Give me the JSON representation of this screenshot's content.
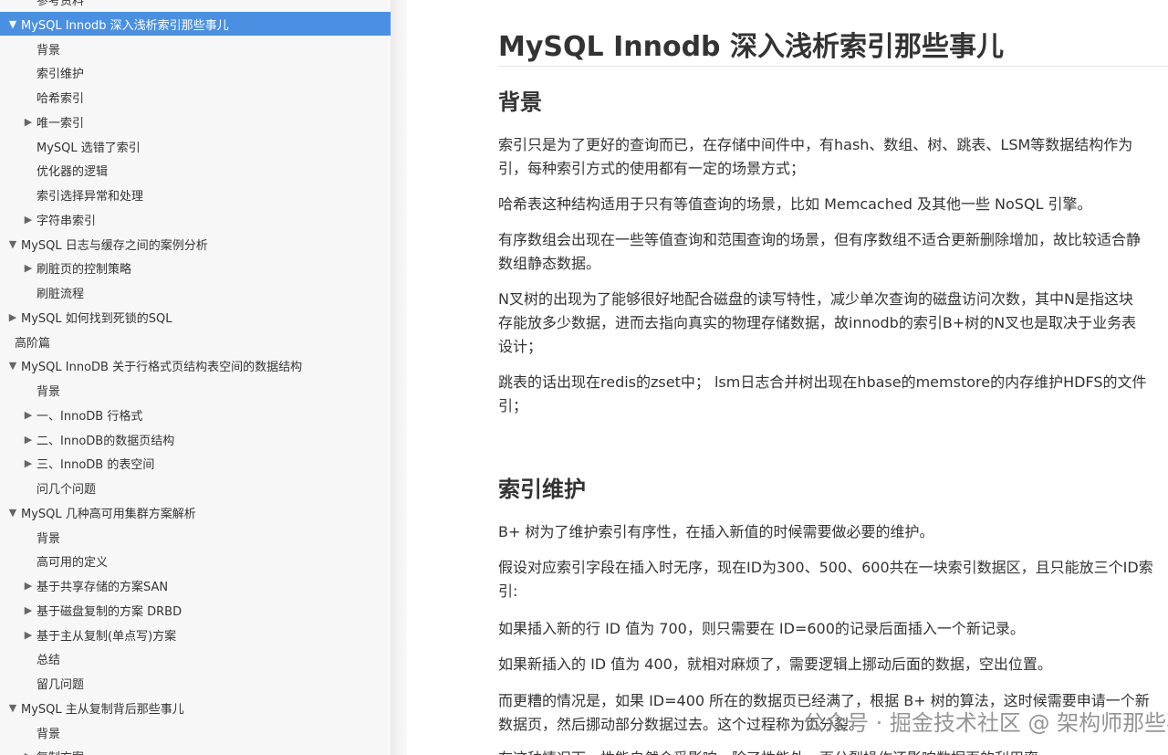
{
  "sidebar": {
    "items": [
      {
        "label": "参考资料",
        "arrow": "",
        "level": 2,
        "active": false
      },
      {
        "label": "MySQL Innodb 深入浅析索引那些事儿",
        "arrow": "▼",
        "level": 1,
        "active": true
      },
      {
        "label": "背景",
        "arrow": "",
        "level": 2,
        "active": false
      },
      {
        "label": "索引维护",
        "arrow": "",
        "level": 2,
        "active": false
      },
      {
        "label": "哈希索引",
        "arrow": "",
        "level": 2,
        "active": false
      },
      {
        "label": "唯一索引",
        "arrow": "▶",
        "level": 2,
        "active": false
      },
      {
        "label": "MySQL 选错了索引",
        "arrow": "",
        "level": 2,
        "active": false
      },
      {
        "label": "优化器的逻辑",
        "arrow": "",
        "level": 2,
        "active": false
      },
      {
        "label": "索引选择异常和处理",
        "arrow": "",
        "level": 2,
        "active": false
      },
      {
        "label": "字符串索引",
        "arrow": "▶",
        "level": 2,
        "active": false
      },
      {
        "label": "MySQL 日志与缓存之间的案例分析",
        "arrow": "▼",
        "level": 1,
        "active": false
      },
      {
        "label": "刷脏页的控制策略",
        "arrow": "▶",
        "level": 2,
        "active": false
      },
      {
        "label": "刷脏流程",
        "arrow": "",
        "level": 2,
        "active": false
      },
      {
        "label": "MySQL 如何找到死锁的SQL",
        "arrow": "▶",
        "level": 1,
        "active": false
      },
      {
        "label": "高阶篇",
        "arrow": "",
        "level": 0,
        "active": false
      },
      {
        "label": "MySQL InnoDB 关于行格式页结构表空间的数据结构",
        "arrow": "▼",
        "level": 1,
        "active": false
      },
      {
        "label": "背景",
        "arrow": "",
        "level": 2,
        "active": false
      },
      {
        "label": "一、InnoDB 行格式",
        "arrow": "▶",
        "level": 2,
        "active": false
      },
      {
        "label": "二、InnoDB的数据页结构",
        "arrow": "▶",
        "level": 2,
        "active": false
      },
      {
        "label": "三、InnoDB 的表空间",
        "arrow": "▶",
        "level": 2,
        "active": false
      },
      {
        "label": "问几个问题",
        "arrow": "",
        "level": 2,
        "active": false
      },
      {
        "label": "MySQL 几种高可用集群方案解析",
        "arrow": "▼",
        "level": 1,
        "active": false
      },
      {
        "label": "背景",
        "arrow": "",
        "level": 2,
        "active": false
      },
      {
        "label": "高可用的定义",
        "arrow": "",
        "level": 2,
        "active": false
      },
      {
        "label": "基于共享存储的方案SAN",
        "arrow": "▶",
        "level": 2,
        "active": false
      },
      {
        "label": "基于磁盘复制的方案 DRBD",
        "arrow": "▶",
        "level": 2,
        "active": false
      },
      {
        "label": "基于主从复制(单点写)方案",
        "arrow": "▶",
        "level": 2,
        "active": false
      },
      {
        "label": "总结",
        "arrow": "",
        "level": 2,
        "active": false
      },
      {
        "label": "留几问题",
        "arrow": "",
        "level": 2,
        "active": false
      },
      {
        "label": "MySQL 主从复制背后那些事儿",
        "arrow": "▼",
        "level": 1,
        "active": false
      },
      {
        "label": "背景",
        "arrow": "",
        "level": 2,
        "active": false
      },
      {
        "label": "复制方案",
        "arrow": "▶",
        "level": 2,
        "active": false
      }
    ]
  },
  "content": {
    "title": "MySQL Innodb 深入浅析索引那些事儿",
    "sections": [
      {
        "heading": "背景",
        "paragraphs": [
          [
            "索引只是为了更好的查询而已，在存储中间件中，有hash、数组、树、跳表、LSM等数据结构作为",
            "引，每种索引方式的使用都有一定的场景方式；"
          ],
          [
            "哈希表这种结构适用于只有等值查询的场景，比如 Memcached 及其他一些 NoSQL 引擎。"
          ],
          [
            "有序数组会出现在一些等值查询和范围查询的场景，但有序数组不适合更新删除增加，故比较适合静",
            "数组静态数据。"
          ],
          [
            "N叉树的出现为了能够很好地配合磁盘的读写特性，减少单次查询的磁盘访问次数，其中N是指这块",
            "存能放多少数据，进而去指向真实的物理存储数据，故innodb的索引B+树的N叉也是取决于业务表",
            "设计；"
          ],
          [
            "跳表的话出现在redis的zset中； lsm日志合并树出现在hbase的memstore的内存维护HDFS的文件",
            "引；"
          ]
        ]
      },
      {
        "heading": "索引维护",
        "paragraphs": [
          [
            "B+ 树为了维护索引有序性，在插入新值的时候需要做必要的维护。"
          ],
          [
            "假设对应索引字段在插入时无序，现在ID为300、500、600共在一块索引数据区，且只能放三个ID索",
            "引:"
          ],
          [
            "如果插入新的行 ID 值为 700，则只需要在 ID=600的记录后面插入一个新记录。"
          ],
          [
            "如果新插入的 ID 值为 400，就相对麻烦了，需要逻辑上挪动后面的数据，空出位置。"
          ],
          [
            "而更糟的情况是，如果 ID=400 所在的数据页已经满了，根据 B+ 树的算法，这时候需要申请一个新",
            "数据页，然后挪动部分数据过去。这个过程称为页分裂。"
          ],
          [
            "在这种情况下，性能自然会受影响。除了性能外，页分裂操作还影响数据页的利用率。"
          ]
        ]
      }
    ]
  },
  "watermark": "公众号 · 掘金技术社区 @ 架构师那些事儿"
}
